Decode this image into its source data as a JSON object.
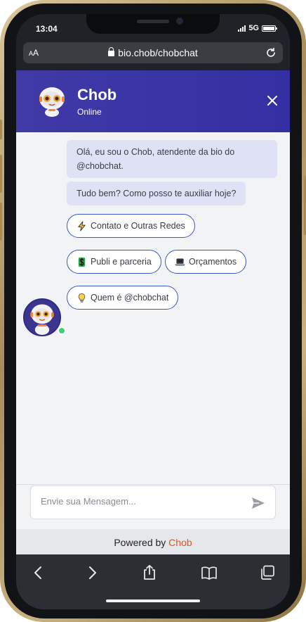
{
  "status_bar": {
    "time": "13:04",
    "network": "5G"
  },
  "browser": {
    "text_size_label_small": "A",
    "text_size_label_large": "A",
    "url": "bio.chob/chobchat"
  },
  "chat_header": {
    "name": "Chob",
    "status": "Online"
  },
  "messages": [
    {
      "text": "Olá, eu sou o Chob, atendente da bio do @chobchat."
    },
    {
      "text": "Tudo bem? Como posso te auxiliar hoje?"
    }
  ],
  "quick_replies": [
    {
      "icon": "lightning-icon",
      "label": "Contato e Outras Redes"
    },
    {
      "icon": "dollar-icon",
      "label": "Publi e parceria"
    },
    {
      "icon": "laptop-icon",
      "label": "Orçamentos"
    },
    {
      "icon": "lightbulb-icon",
      "label": "Quem é @chobchat"
    }
  ],
  "input": {
    "placeholder": "Envie sua Mensagem..."
  },
  "footer": {
    "prefix": "Powered by ",
    "brand": "Chob"
  },
  "colors": {
    "header": "#3430a4",
    "chip_border": "#3a55c8",
    "bubble": "#dfe2f4",
    "brand": "#e6531b",
    "online": "#3fd07a"
  }
}
